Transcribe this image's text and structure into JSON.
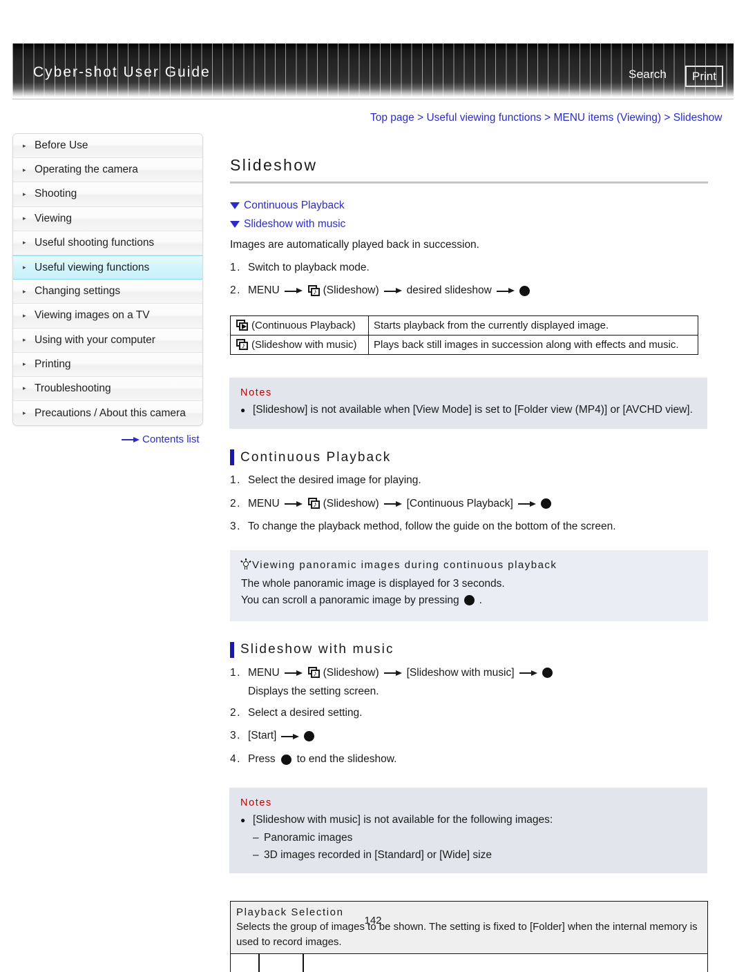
{
  "header": {
    "title": "Cyber-shot User Guide",
    "search_label": "Search",
    "print_label": "Print"
  },
  "breadcrumb": {
    "items": [
      "Top page",
      "Useful viewing functions",
      "MENU items (Viewing)",
      "Slideshow"
    ],
    "separator": ">",
    "link_color": "#2b2bc9"
  },
  "sidebar": {
    "items": [
      {
        "label": "Before Use",
        "active": false
      },
      {
        "label": "Operating the camera",
        "active": false
      },
      {
        "label": "Shooting",
        "active": false
      },
      {
        "label": "Viewing",
        "active": false
      },
      {
        "label": "Useful shooting functions",
        "active": false
      },
      {
        "label": "Useful viewing functions",
        "active": true
      },
      {
        "label": "Changing settings",
        "active": false
      },
      {
        "label": "Viewing images on a TV",
        "active": false
      },
      {
        "label": "Using with your computer",
        "active": false
      },
      {
        "label": "Printing",
        "active": false
      },
      {
        "label": "Troubleshooting",
        "active": false
      },
      {
        "label": "Precautions / About this camera",
        "active": false
      }
    ],
    "contents_list_label": "Contents list",
    "highlight_color": "#c9f1fa"
  },
  "main": {
    "page_title": "Slideshow",
    "anchors": [
      {
        "label": "Continuous Playback",
        "icon": "triangle-down-icon"
      },
      {
        "label": "Slideshow with music",
        "icon": "triangle-down-icon"
      }
    ],
    "intro": "Images are automatically played back in succession.",
    "intro_steps": [
      {
        "num": "1.",
        "text": "Switch to playback mode."
      },
      {
        "num": "2.",
        "parts": [
          "MENU",
          "arrow",
          "slideshow-icon",
          "(Slideshow)",
          "arrow",
          "desired slideshow",
          "arrow",
          "dot"
        ],
        "menu_label": "MENU",
        "icon_label": "(Slideshow)",
        "mid_label": "desired slideshow"
      }
    ],
    "mode_table": {
      "rows": [
        {
          "icon": "slideshow-play-icon",
          "label": "(Continuous Playback)",
          "description": "Starts playback from the currently displayed image."
        },
        {
          "icon": "slideshow-music-icon",
          "label": "(Slideshow with music)",
          "description": "Plays back still images in succession along with effects and music."
        }
      ]
    },
    "notes_1": {
      "title": "Notes",
      "items": [
        "[Slideshow] is not available when [View Mode] is set to [Folder view (MP4)] or [AVCHD view]."
      ]
    },
    "section_continuous": {
      "heading": "Continuous Playback",
      "steps": [
        {
          "num": "1.",
          "text": "Select the desired image for playing."
        },
        {
          "num": "2.",
          "menu_label": "MENU",
          "icon_label": "(Slideshow)",
          "mid_label": "[Continuous Playback]"
        },
        {
          "num": "3.",
          "text": "To change the playback method, follow the guide on the bottom of the screen."
        }
      ]
    },
    "tip_box": {
      "icon": "lightbulb-icon",
      "heading": "Viewing panoramic images during continuous playback",
      "line1": "The whole panoramic image is displayed for 3 seconds.",
      "line2_before": "You can scroll a panoramic image by pressing",
      "line2_after": "."
    },
    "section_music": {
      "heading": "Slideshow with music",
      "step1": {
        "num": "1.",
        "menu_label": "MENU",
        "icon_label": "(Slideshow)",
        "mid_label": "[Slideshow with music]",
        "sub": "Displays the setting screen."
      },
      "step2": {
        "num": "2.",
        "text": "Select a desired setting."
      },
      "step3": {
        "num": "3.",
        "label": "[Start]"
      },
      "step4": {
        "num": "4.",
        "before": "Press",
        "after": "to end the slideshow."
      }
    },
    "notes_2": {
      "title": "Notes",
      "items": [
        "[Slideshow with music] is not available for the following images:"
      ],
      "sub_items": [
        "Panoramic images",
        "3D images recorded in [Standard] or [Wide] size"
      ],
      "dash": "–"
    },
    "bottom_table": {
      "title": "Playback Selection",
      "description": "Selects the group of images to be shown. The setting is fixed to [Folder] when the internal memory is used to record images."
    }
  },
  "footer": {
    "page_number": "142"
  }
}
